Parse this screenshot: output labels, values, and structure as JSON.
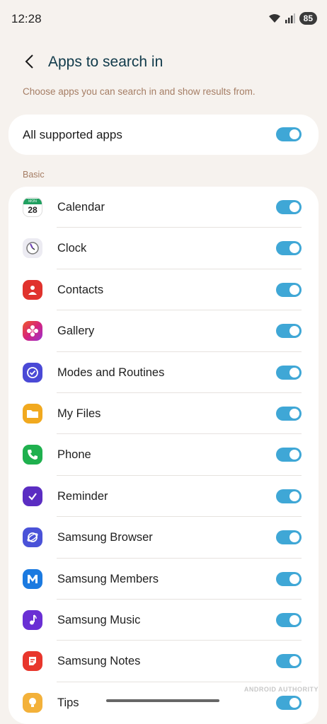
{
  "status": {
    "time": "12:28",
    "battery": "85"
  },
  "header": {
    "title": "Apps to search in"
  },
  "subtitle": "Choose apps you can search in and show results from.",
  "all_supported": {
    "label": "All supported apps",
    "enabled": true
  },
  "section_label": "Basic",
  "apps": [
    {
      "label": "Calendar",
      "icon": "calendar-icon",
      "color": "#ffffff",
      "enabled": true
    },
    {
      "label": "Clock",
      "icon": "clock-icon",
      "color": "#e9e8f0",
      "enabled": true
    },
    {
      "label": "Contacts",
      "icon": "contacts-icon",
      "color": "#e0322d",
      "enabled": true
    },
    {
      "label": "Gallery",
      "icon": "gallery-icon",
      "color": "#d6247a",
      "enabled": true
    },
    {
      "label": "Modes and Routines",
      "icon": "modes-routines-icon",
      "color": "#4a49d6",
      "enabled": true
    },
    {
      "label": "My Files",
      "icon": "my-files-icon",
      "color": "#f1a91f",
      "enabled": true
    },
    {
      "label": "Phone",
      "icon": "phone-icon",
      "color": "#1fb04e",
      "enabled": true
    },
    {
      "label": "Reminder",
      "icon": "reminder-icon",
      "color": "#5b2dc2",
      "enabled": true
    },
    {
      "label": "Samsung Browser",
      "icon": "samsung-browser-icon",
      "color": "#4a52d8",
      "enabled": true
    },
    {
      "label": "Samsung Members",
      "icon": "samsung-members-icon",
      "color": "#1b7ae0",
      "enabled": true
    },
    {
      "label": "Samsung Music",
      "icon": "samsung-music-icon",
      "color": "#6a2fd4",
      "enabled": true
    },
    {
      "label": "Samsung Notes",
      "icon": "samsung-notes-icon",
      "color": "#e8362c",
      "enabled": true
    },
    {
      "label": "Tips",
      "icon": "tips-icon",
      "color": "#f3b13a",
      "enabled": true
    }
  ],
  "calendar_icon": {
    "month": "MON",
    "day": "28"
  }
}
